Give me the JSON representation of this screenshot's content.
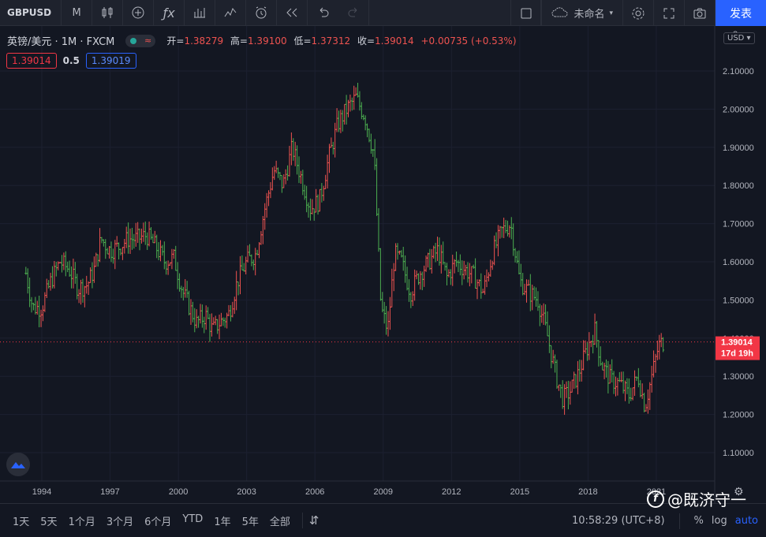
{
  "toolbar": {
    "symbol": "GBPUSD",
    "interval": "M",
    "save_label": "未命名",
    "publish_label": "发表"
  },
  "legend": {
    "title": "英镑/美元 · 1M · FXCM",
    "open_label": "开=",
    "open_value": "1.38279",
    "high_label": "高=",
    "high_value": "1.39100",
    "low_label": "低=",
    "low_value": "1.37312",
    "close_label": "收=",
    "close_value": "1.39014",
    "change": "+0.00735 (+0.53%)",
    "sell_price": "1.39014",
    "spread": "0.5",
    "buy_price": "1.39019"
  },
  "price_axis": {
    "currency": "USD",
    "top_label": "2",
    "current_price": "1.39014",
    "countdown": "17d 19h"
  },
  "bottom": {
    "ranges": [
      "1天",
      "5天",
      "1个月",
      "3个月",
      "6个月",
      "YTD",
      "1年",
      "5年",
      "全部"
    ],
    "time": "10:58:29 (UTC+8)",
    "percent": "%",
    "log": "log",
    "auto": "auto"
  },
  "watermark": "@既济守一",
  "colors": {
    "up": "#ef5350",
    "down": "#4caf50",
    "accent": "#2962ff",
    "bg": "#131722"
  },
  "chart_data": {
    "type": "line",
    "y_ticks": [
      "2.10000",
      "2.00000",
      "1.90000",
      "1.80000",
      "1.70000",
      "1.60000",
      "1.50000",
      "1.40000",
      "1.30000",
      "1.20000",
      "1.10000"
    ],
    "x_ticks": [
      "1994",
      "1997",
      "2000",
      "2003",
      "2006",
      "2009",
      "2012",
      "2015",
      "2018",
      "2021"
    ],
    "ylim": [
      1.05,
      2.17
    ],
    "xlim": [
      1993.3,
      2022.0
    ],
    "series": [
      {
        "x": [
          1993.3,
          1993.6,
          1994.0,
          1994.4,
          1994.8,
          1995.2,
          1995.6,
          1996.0,
          1996.3,
          1996.6,
          1997.0,
          1997.4,
          1997.8,
          1998.2,
          1998.6,
          1999.0,
          1999.4,
          1999.8,
          2000.2,
          2000.5,
          2000.8,
          2001.2,
          2001.5,
          2001.8,
          2002.2,
          2002.6,
          2003.0,
          2003.4,
          2003.8,
          2004.2,
          2004.6,
          2005.0,
          2005.4,
          2005.8,
          2006.2,
          2006.6,
          2007.0,
          2007.4,
          2007.8,
          2008.2,
          2008.6,
          2008.9,
          2009.2,
          2009.5,
          2009.8,
          2010.2,
          2010.6,
          2011.0,
          2011.4,
          2011.8,
          2012.2,
          2012.6,
          2013.0,
          2013.4,
          2013.8,
          2014.2,
          2014.6,
          2015.0,
          2015.4,
          2015.8,
          2016.2,
          2016.6,
          2016.9,
          2017.2,
          2017.6,
          2018.0,
          2018.3,
          2018.6,
          2019.0,
          2019.4,
          2019.8,
          2020.2,
          2020.5,
          2020.8,
          2021.1,
          2021.3
        ],
        "values": [
          1.57,
          1.48,
          1.48,
          1.55,
          1.6,
          1.58,
          1.53,
          1.54,
          1.58,
          1.66,
          1.63,
          1.64,
          1.66,
          1.66,
          1.67,
          1.64,
          1.6,
          1.61,
          1.52,
          1.48,
          1.44,
          1.46,
          1.42,
          1.44,
          1.46,
          1.55,
          1.6,
          1.62,
          1.74,
          1.84,
          1.8,
          1.9,
          1.82,
          1.74,
          1.76,
          1.87,
          1.96,
          2.0,
          2.03,
          1.98,
          1.88,
          1.48,
          1.42,
          1.62,
          1.6,
          1.52,
          1.57,
          1.6,
          1.63,
          1.56,
          1.6,
          1.58,
          1.56,
          1.52,
          1.62,
          1.68,
          1.7,
          1.55,
          1.52,
          1.5,
          1.41,
          1.3,
          1.24,
          1.26,
          1.31,
          1.38,
          1.42,
          1.33,
          1.29,
          1.28,
          1.25,
          1.3,
          1.22,
          1.3,
          1.38,
          1.39
        ]
      }
    ]
  }
}
